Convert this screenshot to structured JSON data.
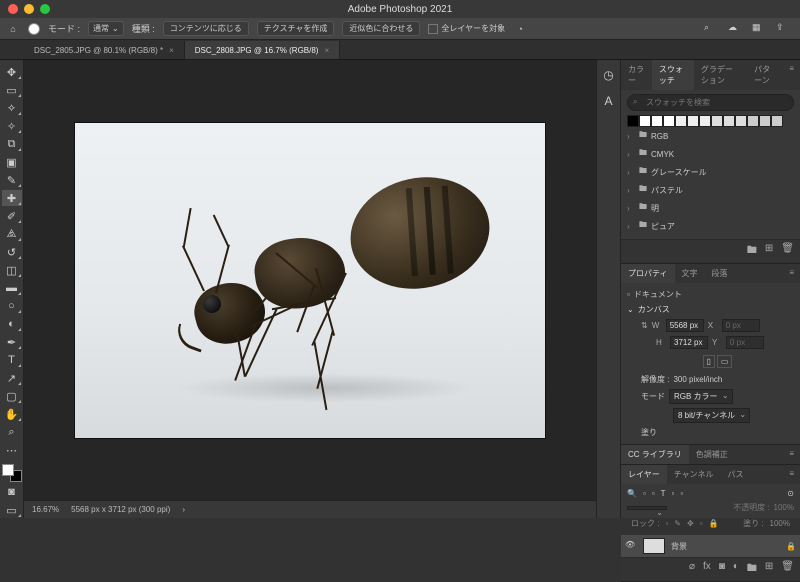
{
  "app": {
    "title": "Adobe Photoshop 2021"
  },
  "optionbar": {
    "mode_label": "モード :",
    "mode_value": "通常",
    "type_label": "種類 :",
    "type_btn": "コンテンツに応じる",
    "texture_btn": "テクスチャを作成",
    "approx_btn": "近似色に合わせる",
    "all_layers_label": "全レイヤーを対象"
  },
  "tabs": [
    {
      "label": "DSC_2805.JPG @ 80.1% (RGB/8) *",
      "active": false
    },
    {
      "label": "DSC_2808.JPG @ 16.7% (RGB/8)",
      "active": true
    }
  ],
  "status": {
    "zoom": "16.67%",
    "docinfo": "5568 px x 3712 px (300 ppi)"
  },
  "swatches": {
    "tabs": [
      "カラー",
      "スウォッチ",
      "グラデーション",
      "パターン"
    ],
    "search_placeholder": "スウォッチを検索",
    "folders": [
      "RGB",
      "CMYK",
      "グレースケール",
      "パステル",
      "明",
      "ピュア"
    ]
  },
  "properties": {
    "tabs": [
      "プロパティ",
      "文字",
      "段落"
    ],
    "doc_label": "ドキュメント",
    "canvas_label": "カンバス",
    "w_label": "W",
    "w_value": "5568 px",
    "h_label": "H",
    "h_value": "3712 px",
    "x_label": "X",
    "x_value": "0 px",
    "y_label": "Y",
    "y_value": "0 px",
    "resolution_label": "解像度 :",
    "resolution_value": "300 pixel/inch",
    "mode_label": "モード",
    "mode_value": "RGB カラー",
    "depth_value": "8 bit/チャンネル",
    "fill_label": "塗り"
  },
  "libraries": {
    "tabs": [
      "CC ライブラリ",
      "色調補正"
    ]
  },
  "layers": {
    "tabs": [
      "レイヤー",
      "チャンネル",
      "パス"
    ],
    "opacity_label": "不透明度 :",
    "opacity_value": "100%",
    "lock_label": "ロック :",
    "fill_label": "塗り :",
    "fill_value": "100%",
    "bg_layer": "背景"
  }
}
